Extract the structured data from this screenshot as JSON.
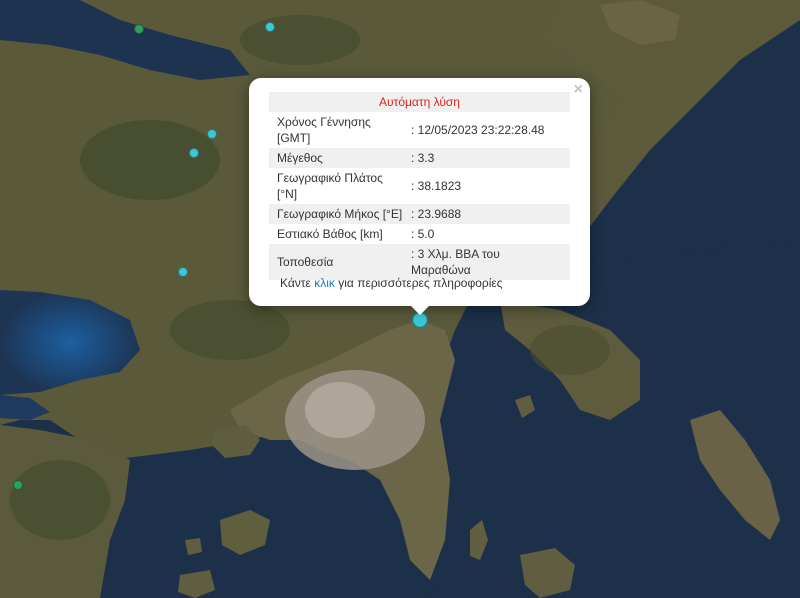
{
  "popup": {
    "title": "Αυτόματη λύση",
    "close_label": "×",
    "rows": [
      {
        "label": "Χρόνος Γέννησης [GMT]",
        "value": ": 12/05/2023 23:22:28.48"
      },
      {
        "label": "Μέγεθος",
        "value": ": 3.3"
      },
      {
        "label": "Γεωγραφικό Πλάτος [°N]",
        "value": ": 38.1823"
      },
      {
        "label": "Γεωγραφικό Μήκος [°E]",
        "value": ": 23.9688"
      },
      {
        "label": "Εστιακό Βάθος [km]",
        "value": ": 5.0"
      },
      {
        "label": "Τοποθεσία",
        "value": ": 3 Χλμ. ΒΒΑ του Μαραθώνα"
      }
    ],
    "more_prefix": "Κάντε",
    "more_link": "κλικ",
    "more_suffix": "για περισσότερες πληροφορίες"
  },
  "map": {
    "sea_color": "#1c3049",
    "land_color": "#5b5a3e",
    "forest_color": "#3f4a2c",
    "urban_color": "#9a9488",
    "marker_cyan": "#3fc6d0",
    "marker_green": "#2f9e5e"
  }
}
